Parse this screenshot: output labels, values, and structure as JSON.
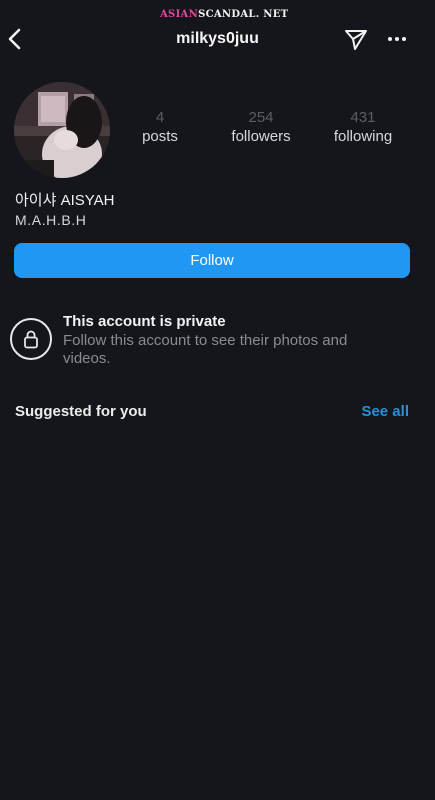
{
  "watermark": {
    "part1": "ASIAN",
    "part2": "SCANDAL",
    "part3": ". NET"
  },
  "header": {
    "username": "milkys0juu"
  },
  "icons": {
    "back": "chevron-left-icon",
    "send": "paper-plane-icon",
    "more": "ellipsis-icon",
    "lock": "lock-icon"
  },
  "profile": {
    "stats": [
      {
        "value": "4",
        "label": "posts"
      },
      {
        "value": "254",
        "label": "followers"
      },
      {
        "value": "431",
        "label": "following"
      }
    ],
    "display_name": "아이샤 AISYAH",
    "bio": "M.A.H.B.H",
    "follow_label": "Follow"
  },
  "private": {
    "title": "This account is private",
    "description": "Follow this account to see their photos and videos."
  },
  "suggested": {
    "title": "Suggested for you",
    "see_all": "See all"
  },
  "colors": {
    "background": "#15161b",
    "accent": "#2098f3",
    "watermark_pink": "#e2459b"
  }
}
